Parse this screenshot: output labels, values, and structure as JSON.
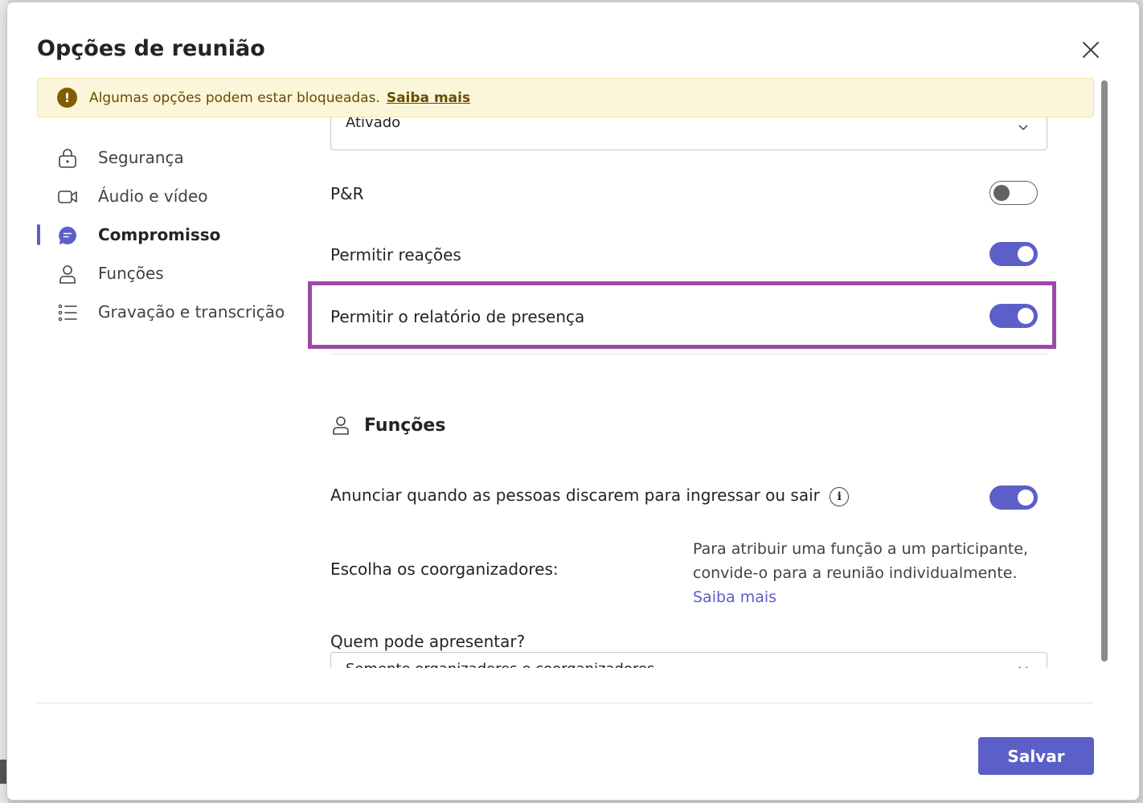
{
  "dialog": {
    "title": "Opções de reunião",
    "close_icon": "close-icon"
  },
  "banner": {
    "icon": "warning-icon",
    "text": "Algumas opções podem estar bloqueadas.",
    "link": "Saiba mais"
  },
  "sidebar": {
    "items": [
      {
        "label": "Segurança",
        "icon": "lock-icon",
        "active": false
      },
      {
        "label": "Áudio e vídeo",
        "icon": "video-camera-icon",
        "active": false
      },
      {
        "label": "Compromisso",
        "icon": "chat-bubble-icon",
        "active": true
      },
      {
        "label": "Funções",
        "icon": "person-icon",
        "active": false
      },
      {
        "label": "Gravação e transcrição",
        "icon": "list-icon",
        "active": false
      }
    ]
  },
  "content": {
    "top_select_value": "Ativado",
    "rows": [
      {
        "label": "P&R",
        "toggle": "off"
      },
      {
        "label": "Permitir reações",
        "toggle": "on"
      },
      {
        "label": "Permitir o relatório de presença",
        "toggle": "on"
      }
    ],
    "roles_section": {
      "title": "Funções",
      "icon": "person-icon",
      "announce_label": "Anunciar quando as pessoas discarem para ingressar ou sair",
      "announce_toggle": "on",
      "info_icon": "info-icon",
      "coorganizers_label": "Escolha os coorganizadores:",
      "coorganizers_desc": "Para atribuir uma função a um participante, convide-o para a reunião individualmente.",
      "coorganizers_link": "Saiba mais",
      "presenters_label": "Quem pode apresentar?",
      "presenters_select_value": "Somente organizadores e coorganizadores"
    }
  },
  "footer": {
    "save_label": "Salvar"
  },
  "colors": {
    "accent": "#5b5fc7",
    "highlight": "#9b4aa6",
    "banner_bg": "#fbf6d9",
    "warning": "#835c00"
  }
}
